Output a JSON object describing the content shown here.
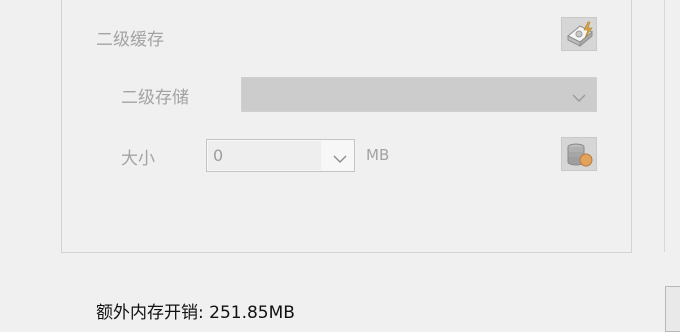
{
  "cache_section": {
    "title": "二级缓存",
    "cache_icon": "cache-settings-icon",
    "storage_label": "二级存储",
    "storage_value": "",
    "size_label": "大小",
    "size_value": "0",
    "size_unit": "MB",
    "db_icon": "database-icon"
  },
  "footer": {
    "overhead_text": "额外内存开销: 251.85MB"
  },
  "colors": {
    "background": "#f0f0f0",
    "disabled_text": "#a3a3a3",
    "disabled_control": "#cccccc"
  }
}
